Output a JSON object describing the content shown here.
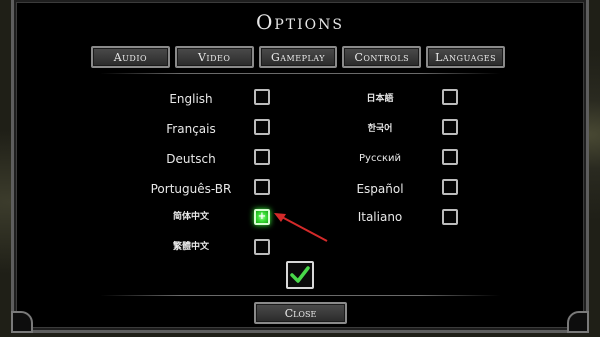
{
  "title": "Options",
  "tabs": [
    {
      "label": "Audio"
    },
    {
      "label": "Video"
    },
    {
      "label": "Gameplay"
    },
    {
      "label": "Controls"
    },
    {
      "label": "Languages"
    }
  ],
  "languages": {
    "left": [
      {
        "label": "English",
        "checked": false
      },
      {
        "label": "Français",
        "checked": false
      },
      {
        "label": "Deutsch",
        "checked": false
      },
      {
        "label": "Português-BR",
        "checked": false
      },
      {
        "label": "简体中文",
        "checked": true
      },
      {
        "label": "繁體中文",
        "checked": false
      }
    ],
    "right": [
      {
        "label": "日本語",
        "checked": false
      },
      {
        "label": "한국어",
        "checked": false
      },
      {
        "label": "Русский",
        "checked": false
      },
      {
        "label": "Español",
        "checked": false
      },
      {
        "label": "Italiano",
        "checked": false
      }
    ],
    "selected_mark": "+"
  },
  "confirm_icon": "check-icon",
  "close_label": "Close",
  "colors": {
    "panel_bg": "#000000",
    "border": "#8a8a8a",
    "selected_green": "#3fe23a",
    "confirm_check": "#49d94a",
    "arrow_red": "#d42a2a"
  }
}
